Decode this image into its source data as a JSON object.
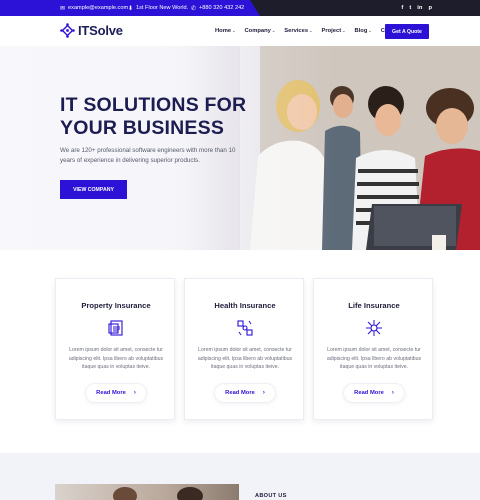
{
  "topbar": {
    "email": "example@example.com",
    "address": "1st Floor New World.",
    "phone": "+880 320 432 242",
    "social": [
      "f",
      "t",
      "in",
      "p"
    ]
  },
  "header": {
    "logo_text": "ITSolve",
    "nav": [
      "Home",
      "Company",
      "Services",
      "Project",
      "Blog",
      "Contact"
    ],
    "nav_has_caret": [
      true,
      true,
      true,
      true,
      true,
      false
    ],
    "cta_label": "Get A Quote"
  },
  "hero": {
    "title_line1": "IT SOLUTIONS FOR",
    "title_line2": "YOUR BUSINESS",
    "text": "We are 120+ professional software engineers with more than 10 years of experience in delivering superior products.",
    "button_label": "VIEW COMPANY"
  },
  "cards": [
    {
      "title": "Property Insurance",
      "icon": "document-icon",
      "text": "Lorem ipsum dolor sit amet, consecte tur adipiscing elit. Ipsa libero ab voluptatibus itaque quas in voluptas iteive.",
      "button": "Read More"
    },
    {
      "title": "Health Insurance",
      "icon": "network-icon",
      "text": "Lorem ipsum dolor sit amet, consecte tur adipiscing elit. Ipsa libero ab voluptatibus itaque quas in voluptas iteive.",
      "button": "Read More"
    },
    {
      "title": "Life Insurance",
      "icon": "hub-icon",
      "text": "Lorem ipsum dolor sit amet, consecte tur adipiscing elit. Ipsa libero ab voluptatibus itaque quas in voluptas iteive.",
      "button": "Read More"
    }
  ],
  "about": {
    "label": "ABOUT US"
  },
  "colors": {
    "accent": "#2b12d6",
    "navy": "#1d1d52",
    "topbar": "#1d1d2b"
  }
}
